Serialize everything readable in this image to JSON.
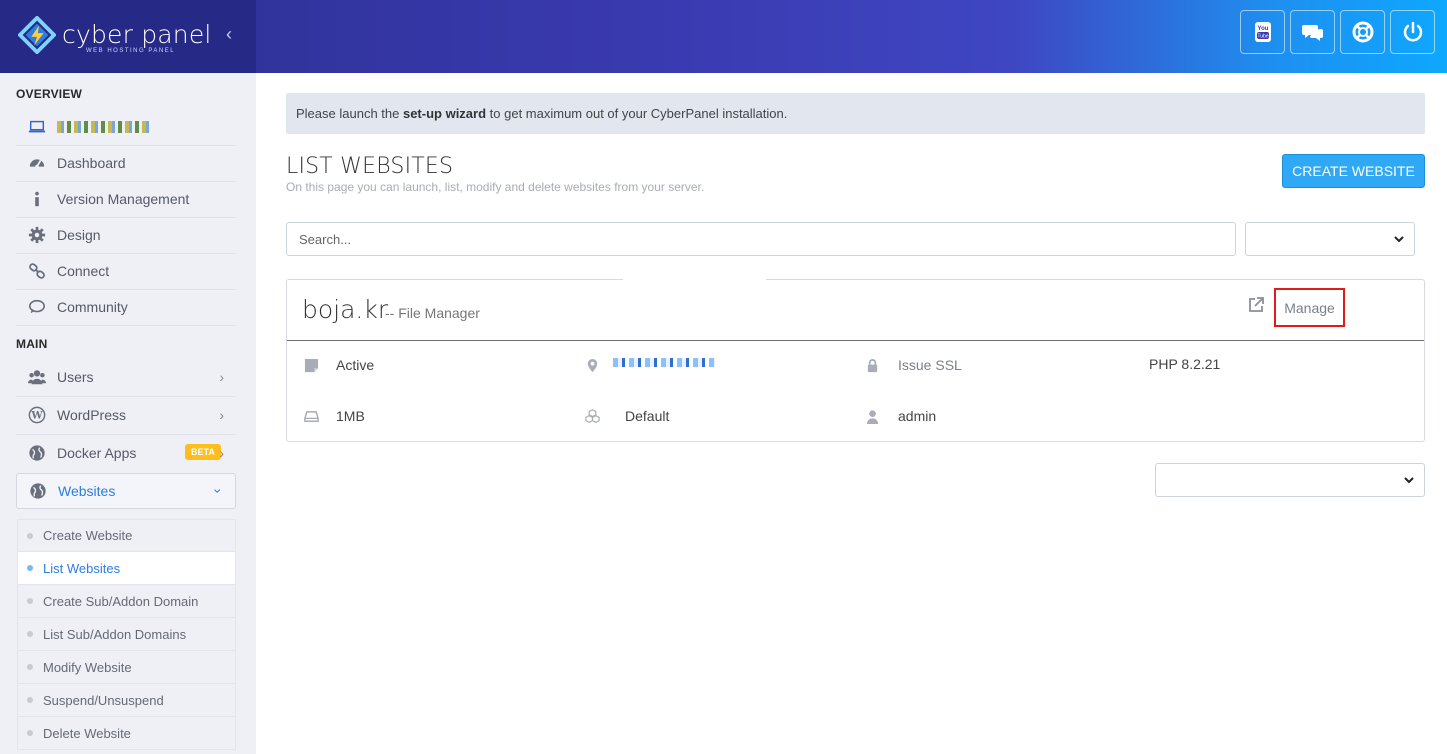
{
  "brand": {
    "name": "cyber panel",
    "subtitle": "WEB HOSTING PANEL",
    "accent_dark": "#262a86",
    "accent_light": "#0ea8ff"
  },
  "header": {
    "buttons": [
      {
        "name": "youtube-icon"
      },
      {
        "name": "chat-icon"
      },
      {
        "name": "lifebuoy-icon"
      },
      {
        "name": "power-icon"
      }
    ]
  },
  "sidebar": {
    "overview_title": "OVERVIEW",
    "overview_items": [
      {
        "label": "Dashboard",
        "icon": "dashboard-icon"
      },
      {
        "label": "Version Management",
        "icon": "info-icon"
      },
      {
        "label": "Design",
        "icon": "gear-icon"
      },
      {
        "label": "Connect",
        "icon": "link-icon"
      },
      {
        "label": "Community",
        "icon": "comments-icon"
      }
    ],
    "main_title": "MAIN",
    "main_items": [
      {
        "label": "Users",
        "icon": "users-icon"
      },
      {
        "label": "WordPress",
        "icon": "wordpress-icon"
      },
      {
        "label": "Docker Apps",
        "icon": "globe-icon",
        "badge": "BETA"
      },
      {
        "label": "Websites",
        "icon": "globe-icon"
      }
    ],
    "websites_sub": [
      {
        "label": "Create Website",
        "active": false
      },
      {
        "label": "List Websites",
        "active": true
      },
      {
        "label": "Create Sub/Addon Domain",
        "active": false
      },
      {
        "label": "List Sub/Addon Domains",
        "active": false
      },
      {
        "label": "Modify Website",
        "active": false
      },
      {
        "label": "Suspend/Unsuspend",
        "active": false
      },
      {
        "label": "Delete Website",
        "active": false
      }
    ]
  },
  "banner": {
    "pre": "Please launch the ",
    "link": "set-up wizard",
    "post": " to get maximum out of your CyberPanel installation."
  },
  "page": {
    "title": "LIST WEBSITES",
    "subtitle": "On this page you can launch, list, modify and delete websites from your server.",
    "create_button": "CREATE WEBSITE",
    "search_placeholder": "Search..."
  },
  "website": {
    "domain": "boja.kr",
    "file_manager": "-- File Manager",
    "manage": "Manage",
    "status": "Active",
    "ssl": "Issue SSL",
    "php": "PHP 8.2.21",
    "disk": "1MB",
    "package": "Default",
    "owner": "admin"
  }
}
